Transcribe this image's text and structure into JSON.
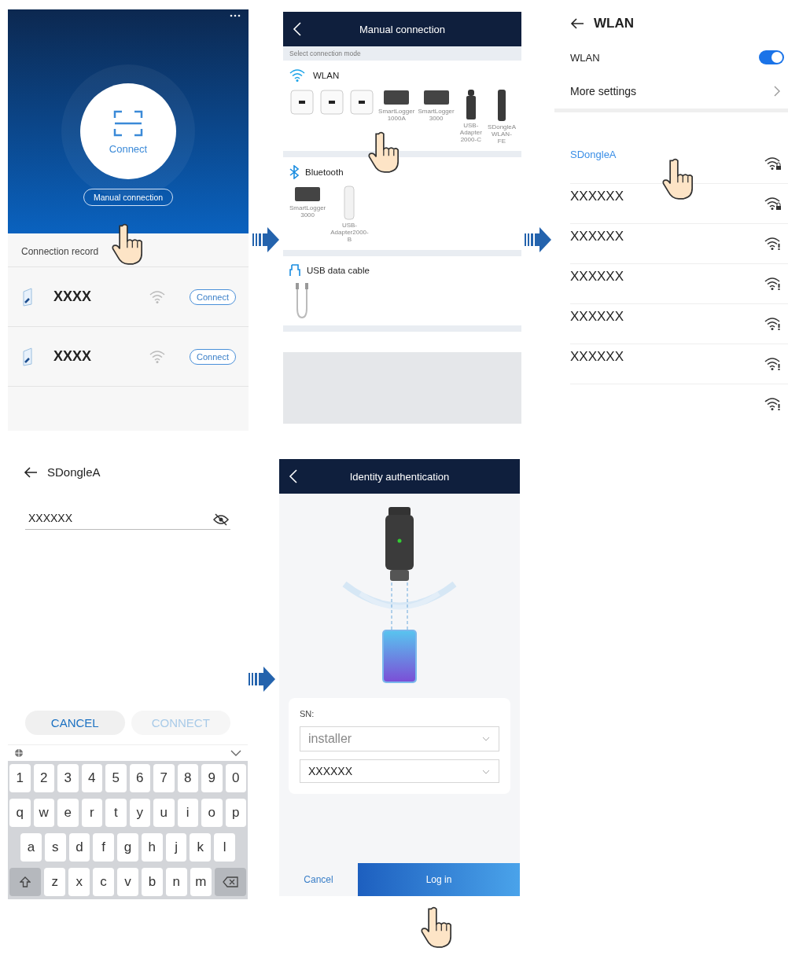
{
  "connect_screen": {
    "scan_label": "Connect",
    "manual_button": "Manual connection",
    "record_heading": "Connection record",
    "records": [
      {
        "name": "XXXX",
        "button": "Connect"
      },
      {
        "name": "XXXX",
        "button": "Connect"
      }
    ]
  },
  "manual_screen": {
    "title": "Manual connection",
    "hint": "Select connection mode",
    "groups": [
      {
        "kind": "wlan",
        "label": "WLAN",
        "devices": [
          {
            "kind": "inverter"
          },
          {
            "kind": "inverter"
          },
          {
            "kind": "inverter"
          },
          {
            "kind": "logger",
            "label": "SmartLogger 1000A"
          },
          {
            "kind": "logger",
            "label": "SmartLogger 3000"
          },
          {
            "kind": "adapter",
            "label": "USB-Adapter 2000-C"
          },
          {
            "kind": "dongle",
            "label": "SDongleA WLAN-FE"
          }
        ]
      },
      {
        "kind": "bluetooth",
        "label": "Bluetooth",
        "devices": [
          {
            "kind": "logger",
            "label": "SmartLogger 3000"
          },
          {
            "kind": "stick",
            "label": "USB-Adapter2000-B"
          }
        ]
      },
      {
        "kind": "usb",
        "label": "USB data cable",
        "devices": [
          {
            "kind": "cable"
          }
        ]
      }
    ]
  },
  "wlan_screen": {
    "title": "WLAN",
    "toggle": {
      "label": "WLAN",
      "on": true
    },
    "more_settings": "More settings",
    "networks": [
      {
        "name": "SDongleA",
        "locked": true,
        "selected": true
      },
      {
        "name": "XXXXXX",
        "locked": true,
        "selected": false
      },
      {
        "name": "XXXXXX",
        "locked": false,
        "selected": false
      },
      {
        "name": "XXXXXX",
        "locked": false,
        "selected": false
      },
      {
        "name": "XXXXXX",
        "locked": false,
        "selected": false
      },
      {
        "name": "XXXXXX",
        "locked": false,
        "selected": false
      },
      {
        "locked": false
      }
    ]
  },
  "password_screen": {
    "title": "SDongleA",
    "password": "XXXXXX",
    "cancel_button": {
      "label": "CANCEL",
      "disabled": false
    },
    "connect_button": {
      "label": "CONNECT",
      "disabled": true
    },
    "keyboard": [
      {
        "kind": "plain",
        "keys": [
          "1",
          "2",
          "3",
          "4",
          "5",
          "6",
          "7",
          "8",
          "9",
          "0"
        ]
      },
      {
        "kind": "plain",
        "keys": [
          "q",
          "w",
          "e",
          "r",
          "t",
          "y",
          "u",
          "i",
          "o",
          "p"
        ]
      },
      {
        "kind": "indented",
        "keys": [
          "a",
          "s",
          "d",
          "f",
          "g",
          "h",
          "j",
          "k",
          "l"
        ]
      },
      {
        "kind": "bottom",
        "keys": [
          "z",
          "x",
          "c",
          "v",
          "b",
          "n",
          "m"
        ]
      }
    ]
  },
  "auth_screen": {
    "title": "Identity authentication",
    "sn_label": "SN:",
    "user": "installer",
    "password": "XXXXXX",
    "cancel": "Cancel",
    "login": "Log in"
  }
}
